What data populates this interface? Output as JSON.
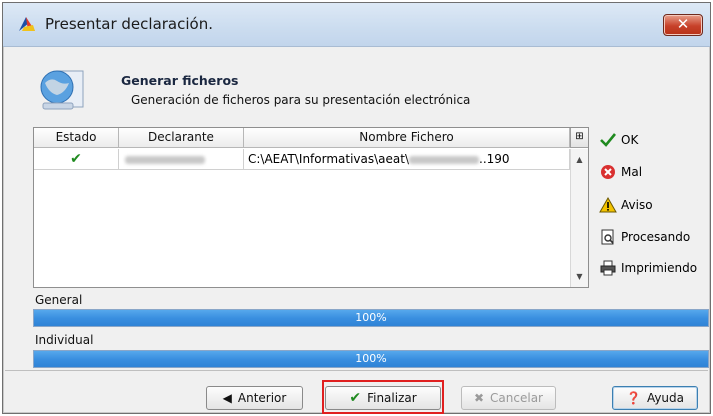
{
  "window": {
    "title": "Presentar declaración.",
    "close_label": "✕"
  },
  "header": {
    "title": "Generar ficheros",
    "subtitle": "Generación de ficheros para su presentación electrónica"
  },
  "table": {
    "columns": [
      "Estado",
      "Declarante",
      "Nombre Fichero"
    ],
    "rows": [
      {
        "estado": "✔",
        "nombre_fichero_prefix": "C:\\AEAT\\Informativas\\aeat\\",
        "nombre_fichero_suffix": "..190"
      }
    ]
  },
  "legend": [
    {
      "icon": "check-icon",
      "label": "OK",
      "color": "#1f8a1f"
    },
    {
      "icon": "error-icon",
      "label": "Mal",
      "color": "#d93030"
    },
    {
      "icon": "warning-icon",
      "label": "Aviso",
      "color": "#f2c200"
    },
    {
      "icon": "processing-icon",
      "label": "Procesando",
      "color": "#333333"
    },
    {
      "icon": "printer-icon",
      "label": "Imprimiendo",
      "color": "#333333"
    }
  ],
  "progress": {
    "general": {
      "label": "General",
      "percent_text": "100%",
      "value": 100
    },
    "individual": {
      "label": "Individual",
      "percent_text": "100%",
      "value": 100
    }
  },
  "buttons": {
    "anterior": "Anterior",
    "finalizar": "Finalizar",
    "cancelar": "Cancelar",
    "ayuda": "Ayuda"
  },
  "colors": {
    "progress_fill": "#3a8fe0",
    "highlight": "#e02020"
  }
}
